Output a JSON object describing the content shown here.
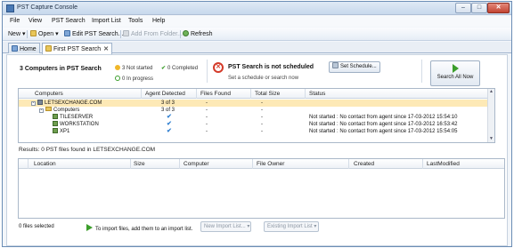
{
  "window": {
    "title": "PST Capture Console",
    "controls": {
      "minimize": "–",
      "maximize": "□",
      "close": "✕"
    }
  },
  "menu": [
    "File",
    "View",
    "PST Search",
    "Import List",
    "Tools",
    "Help"
  ],
  "toolbar": {
    "new_label": "New",
    "open_label": "Open",
    "edit_label": "Edit PST Search...",
    "add_folder_label": "Add From Folder...",
    "refresh_label": "Refresh"
  },
  "tabs": [
    {
      "label": "Home",
      "active": false
    },
    {
      "label": "First PST Search",
      "active": true,
      "close": "✕"
    }
  ],
  "status": {
    "computers_title": "3 Computers in PST Search",
    "not_started": "3 Not started",
    "completed": "0 Completed",
    "in_progress": "0 In progress",
    "schedule_title": "PST Search is not scheduled",
    "schedule_sub": "Set a schedule or search now",
    "set_schedule_label": "Set Schedule...",
    "search_all_label": "Search All Now",
    "colors": {
      "not_started": "#f0b72a",
      "ok": "#3c9e2b",
      "alert": "#d43b2a"
    }
  },
  "computers_table": {
    "columns": [
      "Computers",
      "Agent Detected",
      "Files Found",
      "Total Size",
      "Status"
    ],
    "rows": [
      {
        "name": "LETSEXCHANGE.COM",
        "level": 0,
        "type": "domain",
        "agent": "3 of 3",
        "files": "-",
        "size": "-",
        "status": "",
        "selected": true
      },
      {
        "name": "Computers",
        "level": 1,
        "type": "folder",
        "agent": "3 of 3",
        "files": "-",
        "size": "-",
        "status": "",
        "selected": false
      },
      {
        "name": "TILESERVER",
        "level": 2,
        "type": "computer",
        "agent": "✔",
        "files": "-",
        "size": "-",
        "status": "Not started : No contact from agent since 17-03-2012 15:54:10",
        "selected": false
      },
      {
        "name": "WORKSTATION",
        "level": 2,
        "type": "computer",
        "agent": "✔",
        "files": "-",
        "size": "-",
        "status": "Not started : No contact from agent since 17-03-2012 16:53:42",
        "selected": false
      },
      {
        "name": "XP1",
        "level": 2,
        "type": "computer",
        "agent": "✔",
        "files": "-",
        "size": "-",
        "status": "Not started : No contact from agent since 17-03-2012 15:54:05",
        "selected": false
      }
    ]
  },
  "results": {
    "label": "Results: 0 PST files found in LETSEXCHANGE.COM",
    "columns": [
      "Location",
      "Size",
      "Computer",
      "File Owner",
      "Created",
      "LastModified"
    ]
  },
  "bottom": {
    "files_selected": "0 files selected",
    "import_hint": "To import files, add them to an import list.",
    "new_import_list": "New Import List...",
    "existing_import_list": "Existing Import List"
  }
}
